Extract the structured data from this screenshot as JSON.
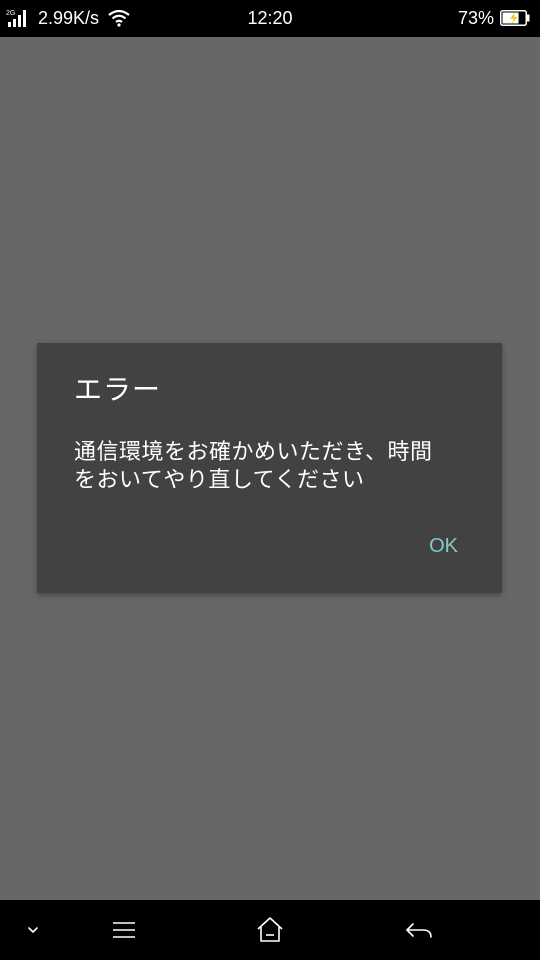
{
  "status_bar": {
    "network_type": "2G",
    "net_speed": "2.99K/s",
    "time": "12:20",
    "battery_percent": "73%",
    "battery_level": 0.73
  },
  "dialog": {
    "title": "エラー",
    "message_line1": "通信環境をお確かめいただき、時間",
    "message_line2": "をおいてやり直してください",
    "ok_label": "OK"
  },
  "nav_bar": {
    "icons": [
      "chevron-down-icon",
      "menu-icon",
      "home-icon",
      "back-icon"
    ]
  }
}
